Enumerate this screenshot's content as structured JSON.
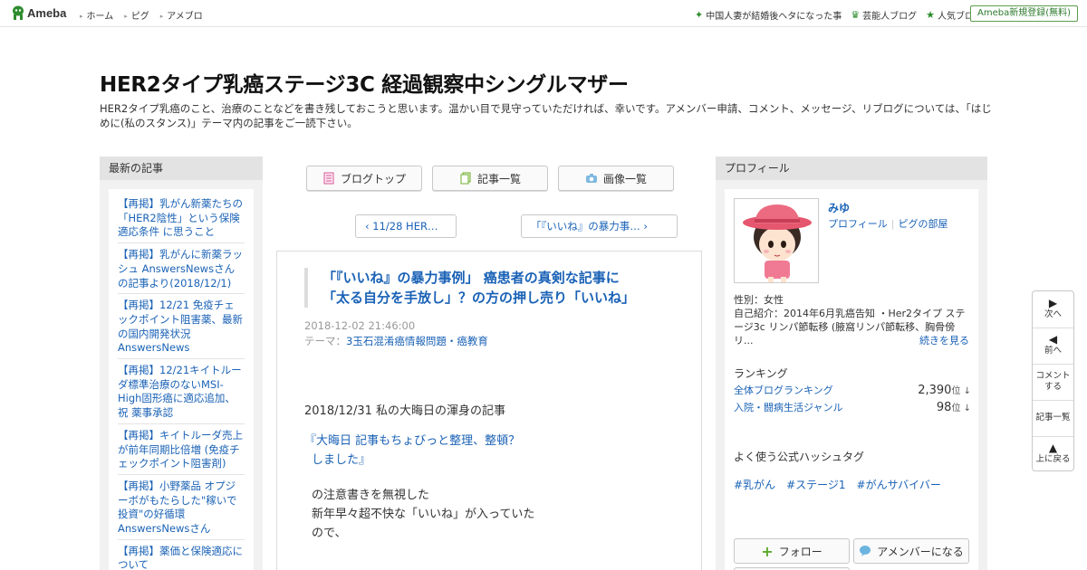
{
  "topbar": {
    "logo": "Ameba",
    "nav": [
      "ホーム",
      "ピグ",
      "アメブロ"
    ],
    "right_links": [
      "中国人妻が結婚後ヘタになった事",
      "芸能人ブログ",
      "人気ブログ"
    ],
    "register": "Ameba新規登録(無料)"
  },
  "header": {
    "title": "HER2タイプ乳癌ステージ3C 経過観察中シングルマザー",
    "description": "HER2タイプ乳癌のこと、治療のことなどを書き残しておこうと思います。温かい目で見守っていただければ、幸いです。アメンバー申請、コメント、メッセージ、リブログについては、「はじめに(私のスタンス)」テーマ内の記事をご一読下さい。"
  },
  "left": {
    "heading": "最新の記事",
    "items": [
      "【再掲】乳がん新薬たちの「HER2陰性」という保険適応条件 に思うこと",
      "【再掲】乳がんに新薬ラッシュ AnswersNewsさんの記事より(2018/12/1)",
      "【再掲】12/21 免疫チェックポイント阻害薬、最新の国内開発状況 AnswersNews",
      "【再掲】12/21キイトルーダ標準治療のないMSI-High固形癌に適応追加、祝 薬事承認",
      "【再掲】キイトルーダ売上が前年同期比倍増 (免疫チェックポイント阻害剤)",
      "【再掲】小野薬品 オプジーボがもたらした\"稼いで投資\"の好循環 AnswersNewsさん",
      "【再掲】薬価と保険適応について"
    ]
  },
  "center": {
    "buttons": [
      "ブログトップ",
      "記事一覧",
      "画像一覧"
    ],
    "prev": "11/28 HER…",
    "next": "「『いいね』の暴力事…",
    "article": {
      "title_line1": "「『いいね』の暴力事例」 癌患者の真剣な記事に",
      "title_line2": "「太る自分を手放し」？の方の押し売り「いいね」",
      "date": "2018-12-02 21:46:00",
      "theme_label": "テーマ：",
      "theme": "3玉石混淆癌情報問題・癌教育",
      "body_line1": "2018/12/31 私の大晦日の渾身の記事",
      "quote_line1": "『大晦日  記事もちょびっと整理、整頓？",
      "quote_line2": "しました』",
      "plain_line1": "の注意書きを無視した",
      "plain_line2": "新年早々超不快な「いいね」が入っていた",
      "plain_line3": "ので、"
    }
  },
  "right": {
    "heading": "プロフィール",
    "name": "みゆ",
    "link_profile": "プロフィール",
    "link_room": "ピグの部屋",
    "gender": "性別：女性",
    "intro": "自己紹介：2014年6月乳癌告知 ・Her2タイプ ステージ3c リンパ節転移 (腋窩リンパ節転移、胸骨傍リ...",
    "more": "続きを見る",
    "ranking_heading": "ランキング",
    "rankings": [
      {
        "label": "全体ブログランキング",
        "value": "2,390",
        "unit": "位 ↓"
      },
      {
        "label": "入院・闘病生活ジャンル",
        "value": "98",
        "unit": "位 ↓"
      }
    ],
    "hashtag_heading": "よく使う公式ハッシュタグ",
    "hashtags": [
      "#乳がん",
      "#ステージ1",
      "#がんサバイバー"
    ],
    "follow": "フォロー",
    "member": "アメンバーになる"
  },
  "float_nav": {
    "next": "次へ",
    "prev": "前へ",
    "comment_1": "コメント",
    "comment_2": "する",
    "list": "記事一覧",
    "top": "上に戻る"
  },
  "colors": {
    "link": "#1a62b6",
    "brand_green": "#2d8c2d",
    "panel_bg": "#f1f1f1"
  }
}
